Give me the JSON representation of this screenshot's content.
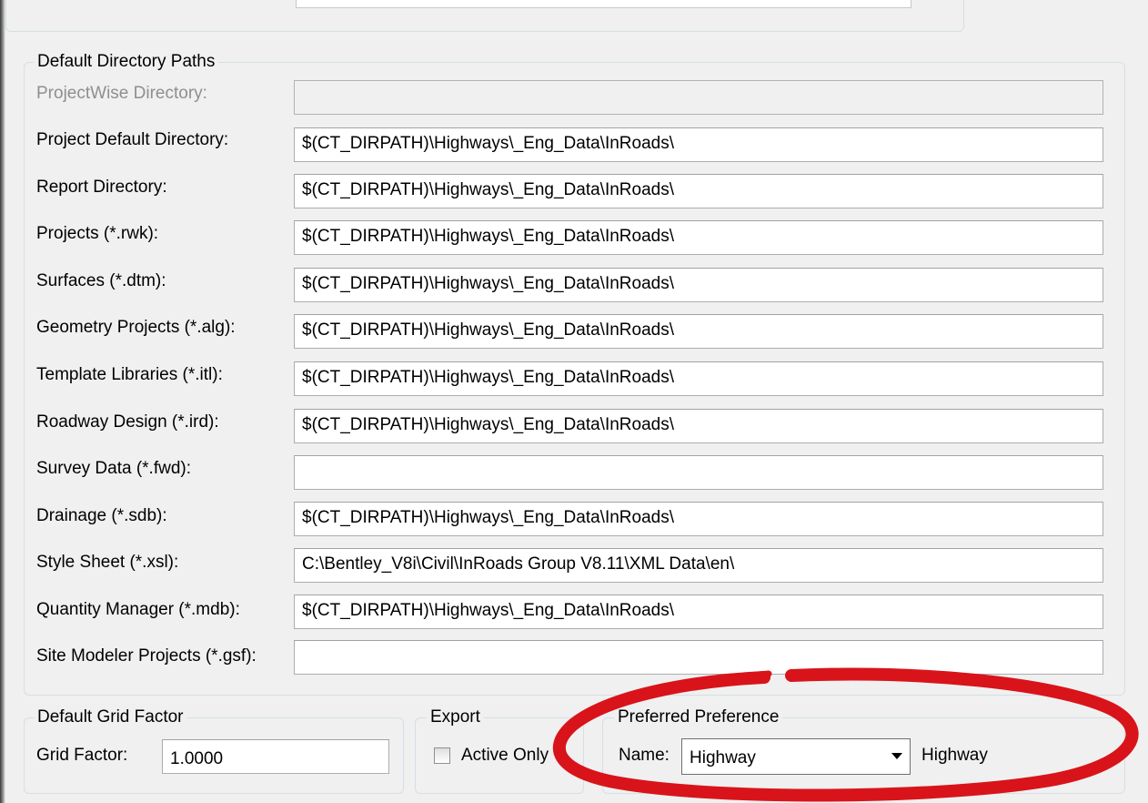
{
  "directory_paths": {
    "title": "Default Directory Paths",
    "rows": [
      {
        "label": "ProjectWise Directory:",
        "value": "",
        "disabled": true
      },
      {
        "label": "Project Default Directory:",
        "value": "$(CT_DIRPATH)\\Highways\\_Eng_Data\\InRoads\\"
      },
      {
        "label": "Report Directory:",
        "value": "$(CT_DIRPATH)\\Highways\\_Eng_Data\\InRoads\\"
      },
      {
        "label": "Projects (*.rwk):",
        "value": "$(CT_DIRPATH)\\Highways\\_Eng_Data\\InRoads\\"
      },
      {
        "label": "Surfaces (*.dtm):",
        "value": "$(CT_DIRPATH)\\Highways\\_Eng_Data\\InRoads\\"
      },
      {
        "label": "Geometry Projects (*.alg):",
        "value": "$(CT_DIRPATH)\\Highways\\_Eng_Data\\InRoads\\"
      },
      {
        "label": "Template Libraries (*.itl):",
        "value": "$(CT_DIRPATH)\\Highways\\_Eng_Data\\InRoads\\"
      },
      {
        "label": "Roadway Design (*.ird):",
        "value": "$(CT_DIRPATH)\\Highways\\_Eng_Data\\InRoads\\"
      },
      {
        "label": "Survey Data (*.fwd):",
        "value": ""
      },
      {
        "label": "Drainage (*.sdb):",
        "value": "$(CT_DIRPATH)\\Highways\\_Eng_Data\\InRoads\\"
      },
      {
        "label": "Style Sheet (*.xsl):",
        "value": "C:\\Bentley_V8i\\Civil\\InRoads Group V8.11\\XML Data\\en\\"
      },
      {
        "label": "Quantity Manager (*.mdb):",
        "value": "$(CT_DIRPATH)\\Highways\\_Eng_Data\\InRoads\\"
      },
      {
        "label": "Site Modeler Projects (*.gsf):",
        "value": ""
      }
    ]
  },
  "grid_factor": {
    "title": "Default Grid Factor",
    "label": "Grid Factor:",
    "value": "1.0000"
  },
  "export": {
    "title": "Export",
    "checkbox_label": "Active Only",
    "checked": false
  },
  "preferred_preference": {
    "title": "Preferred Preference",
    "name_label": "Name:",
    "selected": "Highway",
    "current_name": "Highway"
  },
  "annotation": {
    "color": "#d8141a"
  }
}
